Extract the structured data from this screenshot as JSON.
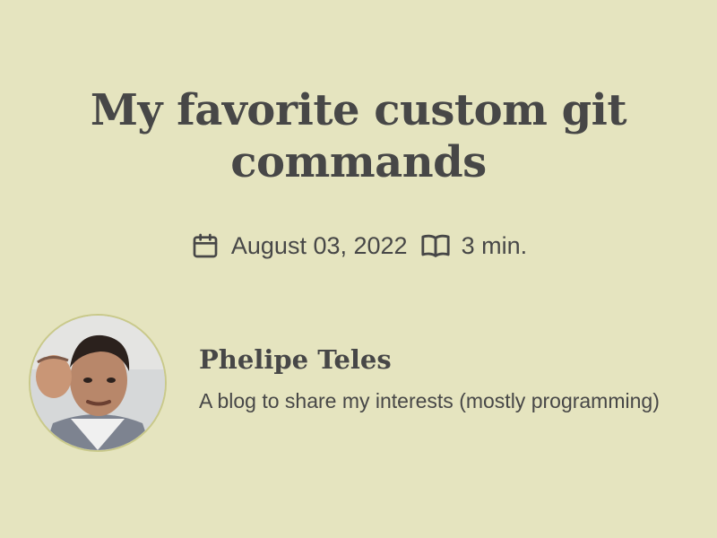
{
  "post": {
    "title": "My favorite custom git commands",
    "date": "August 03, 2022",
    "reading_time": "3 min."
  },
  "icons": {
    "date": "calendar-icon",
    "reading_time": "book-open-icon"
  },
  "author": {
    "name": "Phelipe Teles",
    "bio": "A blog to share my interests (mostly programming)",
    "avatar_icon": "avatar-photo"
  },
  "colors": {
    "background": "#e5e4bf",
    "text": "#474747",
    "avatar_border": "#c9c98a"
  }
}
